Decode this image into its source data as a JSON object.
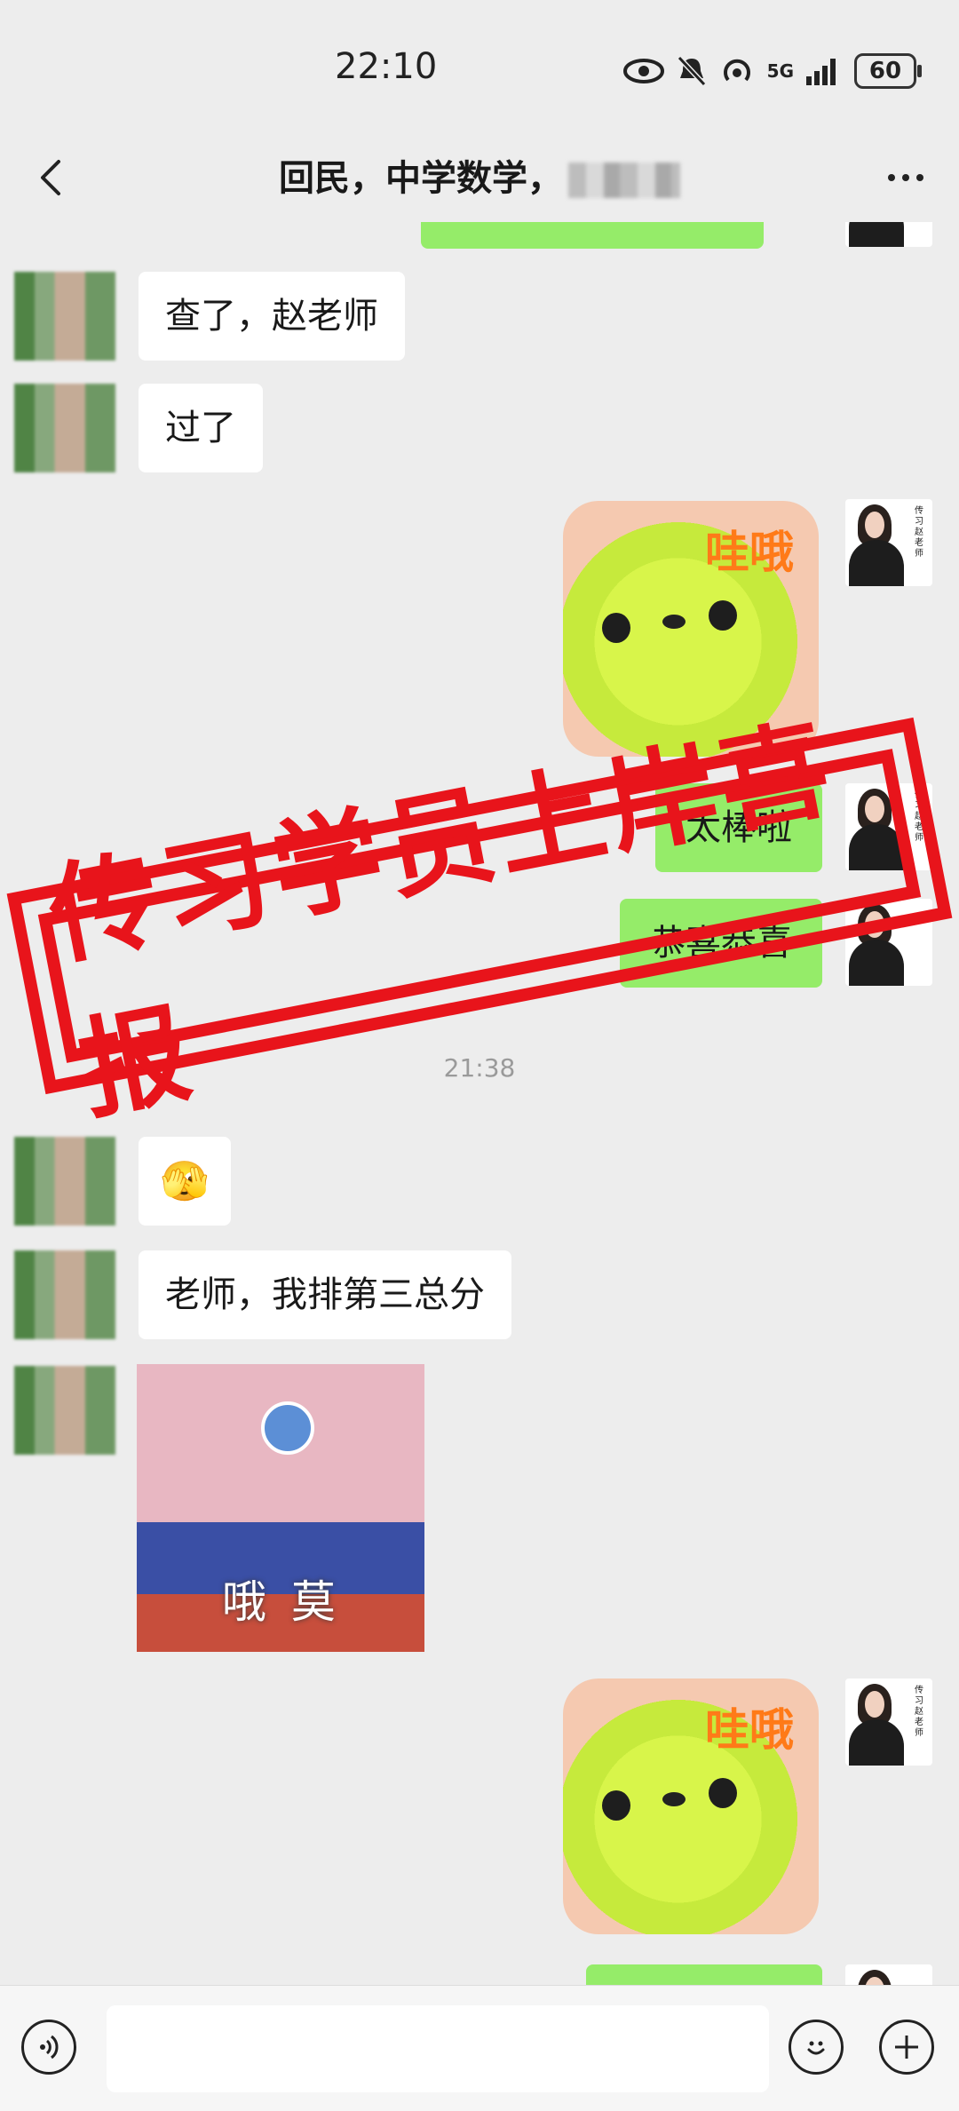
{
  "status": {
    "time": "22:10",
    "network": "5G",
    "battery": "60"
  },
  "nav": {
    "title": "回民，中学数学，"
  },
  "messages": {
    "m1": "查了，赵老师",
    "m2": "过了",
    "sticker_text": "哇哦",
    "m3": "太棒啦",
    "m4": "恭喜恭喜",
    "time_label": "21:38",
    "emoji": "🫣",
    "m5": "老师，我排第三总分",
    "bunny_caption": "哦 莫"
  },
  "watermark": {
    "text": "传习学员上岸喜报"
  },
  "avatar_signature": "传习赵老师",
  "colors": {
    "bubble_green": "#95ec69",
    "stamp_red": "#e8141b"
  }
}
